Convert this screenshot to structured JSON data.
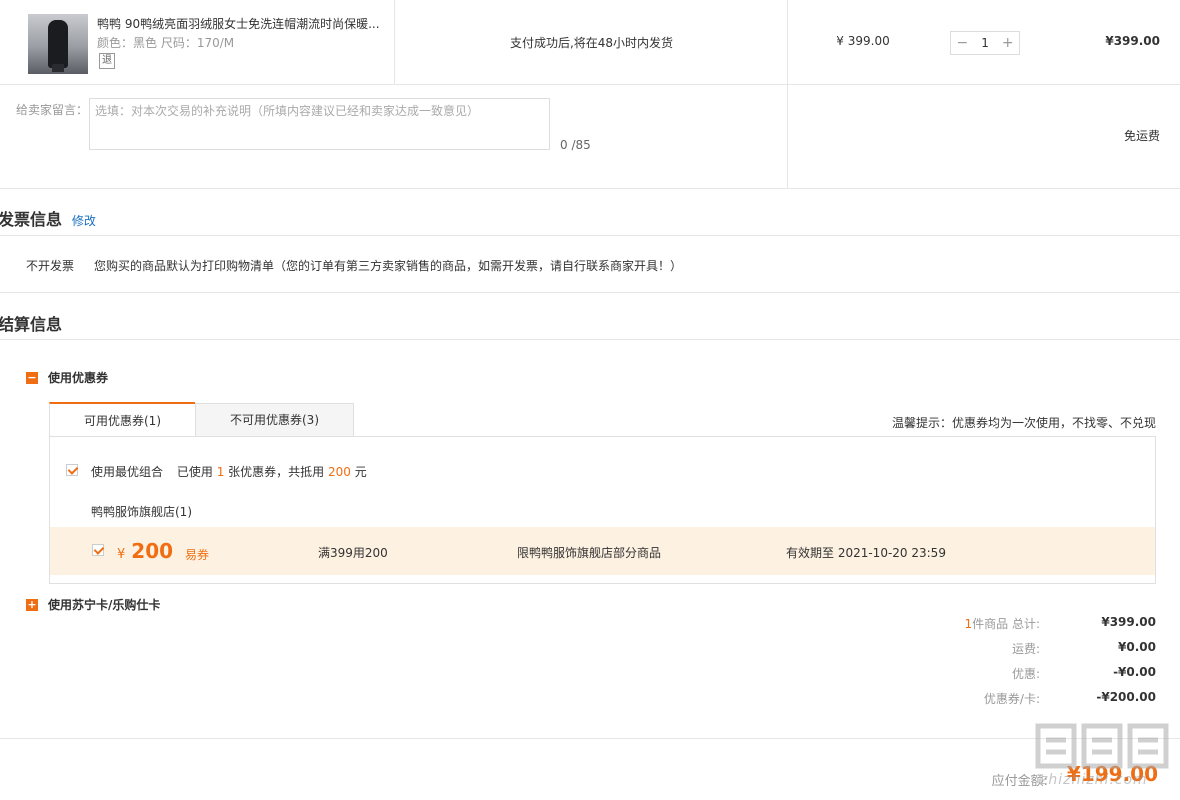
{
  "product": {
    "name": "鸭鸭 90鸭绒亮面羽绒服女士免洗连帽潮流时尚保暖...",
    "spec": "颜色：黑色   尺码：170/M",
    "return_badge": "退",
    "shipping": "支付成功后,将在48小时内发货",
    "price": "¥ 399.00",
    "qty": "1",
    "qty_minus": "−",
    "qty_plus": "+",
    "subtotal": "¥399.00"
  },
  "message": {
    "label": "给卖家留言：",
    "placeholder": "选填：对本次交易的补充说明（所填内容建议已经和卖家达成一致意见）",
    "counter": "0 /85",
    "freight": "免运费"
  },
  "invoice": {
    "title": "发票信息",
    "edit": "修改",
    "type": "不开发票",
    "desc": "您购买的商品默认为打印购物清单（您的订单有第三方卖家销售的商品，如需开发票，请自行联系商家开具！）"
  },
  "settlement": {
    "title": "结算信息",
    "coupon_group": "使用优惠券",
    "tabs": [
      "可用优惠券(1)",
      "不可用优惠券(3)"
    ],
    "tip": "温馨提示：优惠券均为一次使用，不找零、不兑现",
    "best_combo": {
      "label": "使用最优组合",
      "used_prefix": "已使用",
      "count": "1",
      "used_mid": "张优惠券，共抵用",
      "amount": "200",
      "used_suffix": "元"
    },
    "shop": "鸭鸭服饰旗舰店(1)",
    "coupon": {
      "currency": "¥",
      "value": "200",
      "tag": "易券",
      "condition": "满399用200",
      "scope": "限鸭鸭服饰旗舰店部分商品",
      "expiry": "有效期至 2021-10-20 23:59"
    },
    "card_group": "使用苏宁卡/乐购仕卡"
  },
  "summary": {
    "count": "1",
    "count_label": "件商品 总计:",
    "total": "¥399.00",
    "freight_label": "运费:",
    "freight": "¥0.00",
    "discount_label": "优惠:",
    "discount": "-¥0.00",
    "coupon_label": "优惠券/卡:",
    "coupon": "-¥200.00",
    "pay_label": "应付金额:",
    "pay": "¥199.00"
  },
  "watermark": "zhizhizhi.com",
  "colors": {
    "accent": "#f06e13",
    "link": "#1a6fc2",
    "coupon_bg": "#fdf1e1"
  }
}
